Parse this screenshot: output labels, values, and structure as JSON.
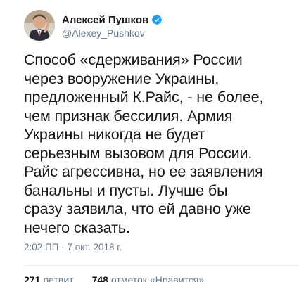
{
  "user": {
    "display_name": "Алексей Пушков",
    "handle": "@Alexey_Pushkov",
    "verified": true
  },
  "tweet": {
    "text": "Способ «сдерживания» России\nчерез вооружение Украины,\nпредложенный К.Райс, - не более,\nчем признак бессилия. Армия\nУкраины никогда не будет\nсерьезным вызовом для России.\nРайс агрессивна, но ее заявления\nбанальны и пусты. Лучше бы\nсразу заявила, что ей давно уже\nнечего сказать.",
    "timestamp": "2:02 ПП · 7 окт. 2018 г."
  },
  "stats": {
    "retweets_count": "271",
    "retweets_label": "ретвит",
    "likes_count": "748",
    "likes_label": "отметок «Нравится»"
  },
  "colors": {
    "verified": "#1da1f2",
    "secondary_text": "#657786",
    "primary_text": "#14171a"
  }
}
